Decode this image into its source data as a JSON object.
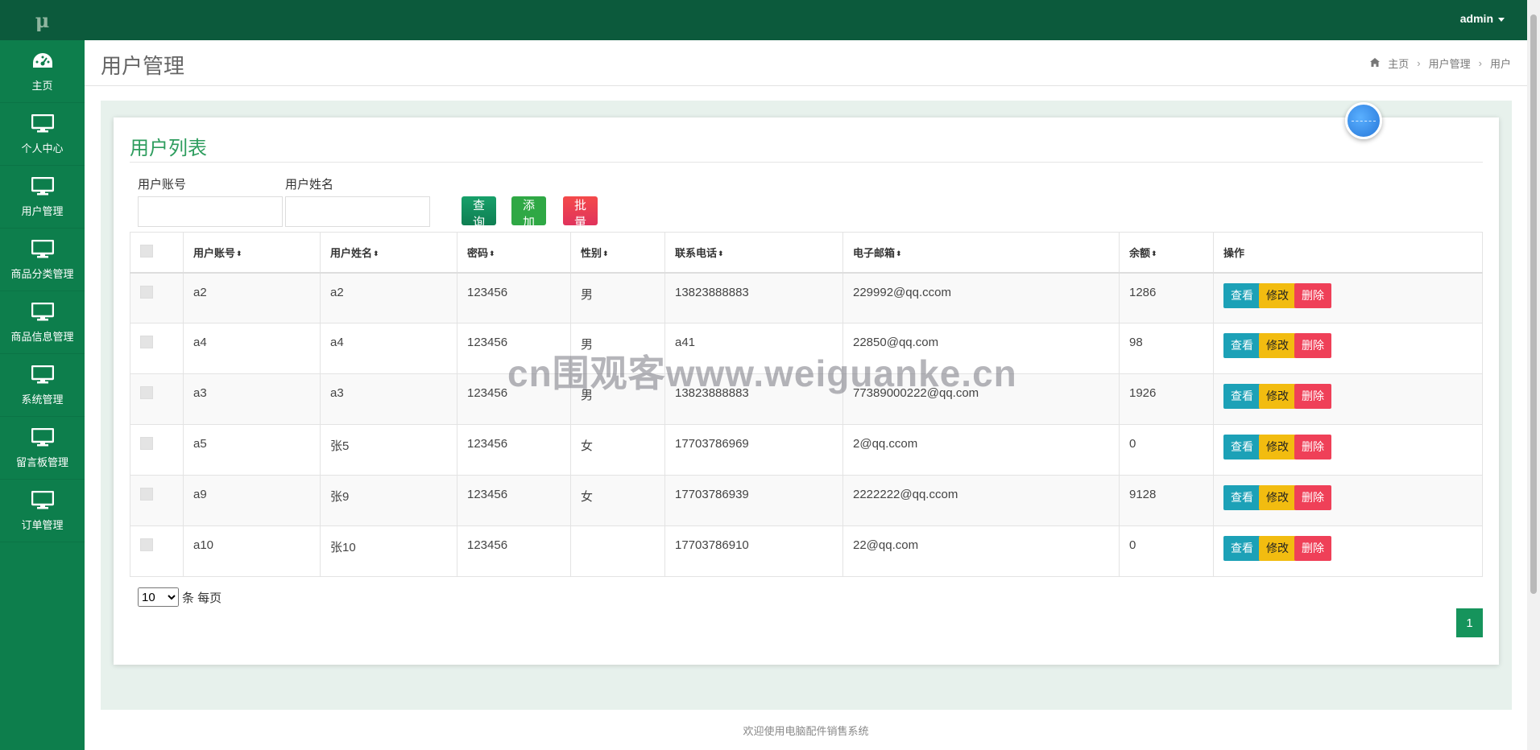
{
  "sidebar": {
    "logo": "μ",
    "items": [
      {
        "label": "主页",
        "icon": "dashboard-icon"
      },
      {
        "label": "个人中心",
        "icon": "monitor-icon"
      },
      {
        "label": "用户管理",
        "icon": "monitor-icon"
      },
      {
        "label": "商品分类管理",
        "icon": "monitor-icon"
      },
      {
        "label": "商品信息管理",
        "icon": "monitor-icon"
      },
      {
        "label": "系统管理",
        "icon": "monitor-icon"
      },
      {
        "label": "留言板管理",
        "icon": "monitor-icon"
      },
      {
        "label": "订单管理",
        "icon": "monitor-icon"
      }
    ]
  },
  "topbar": {
    "user": "admin"
  },
  "header": {
    "title": "用户管理",
    "breadcrumb": [
      "主页",
      "用户管理",
      "用户"
    ]
  },
  "card": {
    "title": "用户列表"
  },
  "search": {
    "account_label": "用户账号",
    "name_label": "用户姓名",
    "account_value": "",
    "name_value": "",
    "query_label": "查询",
    "add_label": "添加",
    "batch_delete_label": "批量删除"
  },
  "table": {
    "columns": [
      "用户账号",
      "用户姓名",
      "密码",
      "性别",
      "联系电话",
      "电子邮箱",
      "余额",
      "操作"
    ],
    "rows": [
      [
        "a2",
        "a2",
        "123456",
        "男",
        "13823888883",
        "229992@qq.ccom",
        "1286"
      ],
      [
        "a4",
        "a4",
        "123456",
        "男",
        "a41",
        "22850@qq.com",
        "98"
      ],
      [
        "a3",
        "a3",
        "123456",
        "男",
        "13823888883",
        "77389000222@qq.com",
        "1926"
      ],
      [
        "a5",
        "张5",
        "123456",
        "女",
        "17703786969",
        "2@qq.ccom",
        "0"
      ],
      [
        "a9",
        "张9",
        "123456",
        "女",
        "17703786939",
        "2222222@qq.ccom",
        "9128"
      ],
      [
        "a10",
        "张10",
        "123456",
        "",
        "17703786910",
        "22@qq.com",
        "0"
      ]
    ],
    "actions": {
      "view": "查看",
      "edit": "修改",
      "delete": "删除"
    }
  },
  "pager": {
    "page_size": "10",
    "page_size_suffix": "条 每页",
    "current_page": "1"
  },
  "footer": {
    "text": "欢迎使用电脑配件销售系统"
  },
  "watermark": "cn围观客www.weiguanke.cn",
  "colors": {
    "sidebar": "#0d7e4c",
    "topbar": "#0c5a3c",
    "accent": "#2e9d5e"
  }
}
